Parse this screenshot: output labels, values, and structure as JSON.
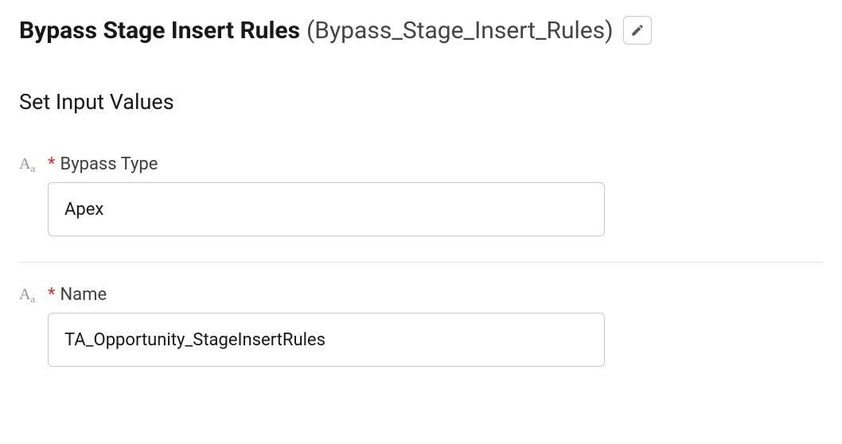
{
  "header": {
    "title": "Bypass Stage Insert Rules",
    "api_name": "(Bypass_Stage_Insert_Rules)"
  },
  "section": {
    "title": "Set Input Values"
  },
  "fields": {
    "bypass_type": {
      "label": "Bypass Type",
      "value": "Apex"
    },
    "name": {
      "label": "Name",
      "value": "TA_Opportunity_StageInsertRules"
    }
  }
}
